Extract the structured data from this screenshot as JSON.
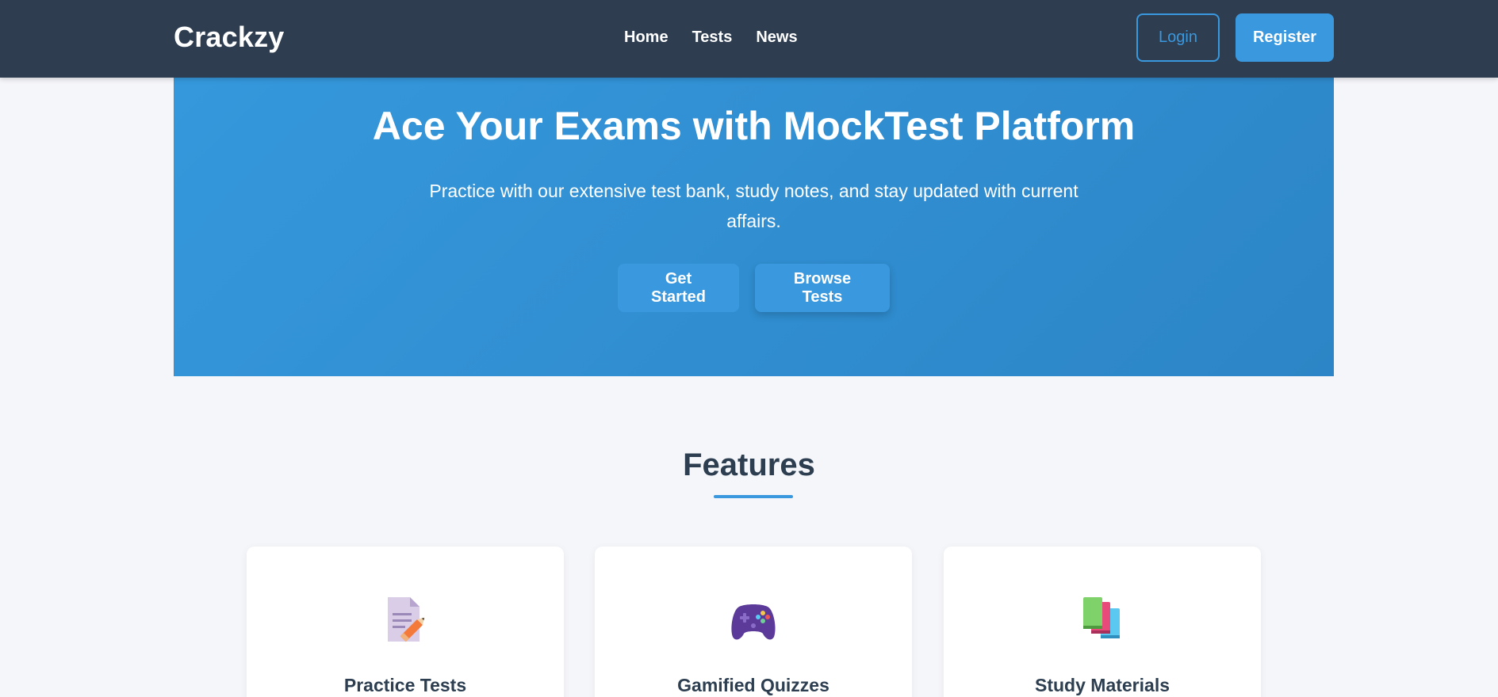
{
  "nav": {
    "brand": "Crackzy",
    "links": [
      "Home",
      "Tests",
      "News"
    ],
    "login_label": "Login",
    "register_label": "Register"
  },
  "hero": {
    "title": "Ace Your Exams with MockTest Platform",
    "subtitle": "Practice with our extensive test bank, study notes, and stay updated with current affairs.",
    "get_started_label": "Get Started",
    "browse_tests_label": "Browse Tests"
  },
  "features": {
    "title": "Features",
    "cards": [
      {
        "title": "Practice Tests",
        "icon": "memo-pencil-icon"
      },
      {
        "title": "Gamified Quizzes",
        "icon": "game-controller-icon"
      },
      {
        "title": "Study Materials",
        "icon": "books-icon"
      }
    ]
  },
  "colors": {
    "navbar_bg": "#2e3d50",
    "accent": "#3a98de",
    "hero_bg": "#3598dc",
    "page_bg": "#f5f6fa",
    "heading_text": "#2c3e50"
  }
}
